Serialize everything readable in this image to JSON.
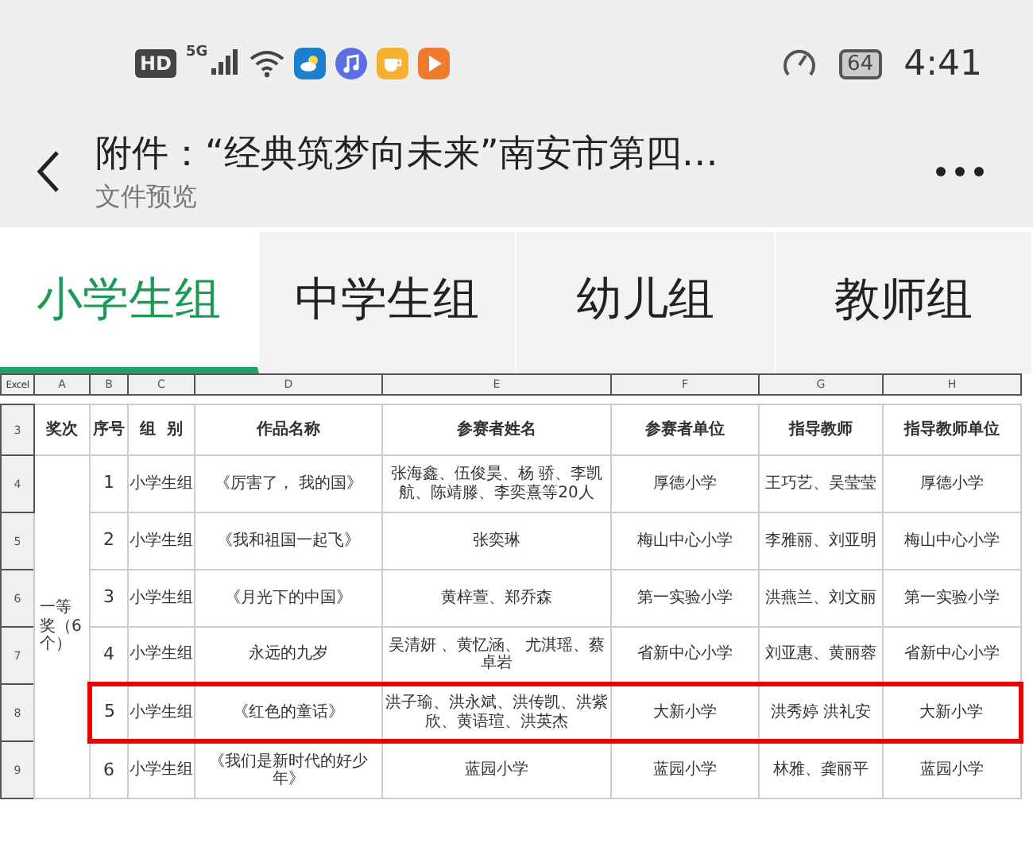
{
  "status_bar": {
    "network_badge": "HD",
    "network_type": "5G",
    "battery": "64",
    "time": "4:41"
  },
  "header": {
    "title": "附件：“经典筑梦向未来”南安市第四…",
    "subtitle": "文件预览"
  },
  "tabs": [
    {
      "label": "小学生组",
      "selected": true
    },
    {
      "label": "中学生组",
      "selected": false
    },
    {
      "label": "幼儿组",
      "selected": false
    },
    {
      "label": "教师组",
      "selected": false
    }
  ],
  "sheet": {
    "corner": "Excel",
    "column_letters": [
      "A",
      "B",
      "C",
      "D",
      "E",
      "F",
      "G",
      "H"
    ],
    "header_row": {
      "row_number": "3",
      "cells": [
        "奖次",
        "序号",
        "组  别",
        "作品名称",
        "参赛者姓名",
        "参赛者单位",
        "指导教师",
        "指导教师单位"
      ]
    },
    "award": "一等奖（6个）",
    "rows": [
      {
        "row_number": "4",
        "no": "1",
        "group": "小学生组",
        "work": "《厉害了， 我的国》",
        "participants": "张海鑫、伍俊昊、杨  骄、李凯航、陈靖滕、李奕熹等20人",
        "unit": "厚德小学",
        "teacher": "王巧艺、吴莹莹",
        "teacher_unit": "厚德小学",
        "highlighted": false
      },
      {
        "row_number": "5",
        "no": "2",
        "group": "小学生组",
        "work": "《我和祖国一起飞》",
        "participants": "张奕琳",
        "unit": "梅山中心小学",
        "teacher": "李雅丽、刘亚明",
        "teacher_unit": "梅山中心小学",
        "highlighted": false
      },
      {
        "row_number": "6",
        "no": "3",
        "group": "小学生组",
        "work": "《月光下的中国》",
        "participants": "黄梓萱、郑乔森",
        "unit": "第一实验小学",
        "teacher": "洪燕兰、刘文丽",
        "teacher_unit": "第一实验小学",
        "highlighted": false
      },
      {
        "row_number": "7",
        "no": "4",
        "group": "小学生组",
        "work": "永远的九岁",
        "participants": "吴清妍 、黄忆涵、 尤淇瑶、蔡卓岩",
        "unit": "省新中心小学",
        "teacher": "刘亚惠、黄丽蓉",
        "teacher_unit": "省新中心小学",
        "highlighted": false
      },
      {
        "row_number": "8",
        "no": "5",
        "group": "小学生组",
        "work": "《红色的童话》",
        "participants": "洪子瑜、洪永斌、洪传凯、洪紫欣、黄语瑄、洪英杰",
        "unit": "大新小学",
        "teacher": "洪秀婷 洪礼安",
        "teacher_unit": "大新小学",
        "highlighted": true
      },
      {
        "row_number": "9",
        "no": "6",
        "group": "小学生组",
        "work": "《我们是新时代的好少年》",
        "participants": "蓝园小学",
        "unit": "蓝园小学",
        "teacher": "林雅、龚丽平",
        "teacher_unit": "蓝园小学",
        "highlighted": false
      }
    ]
  }
}
